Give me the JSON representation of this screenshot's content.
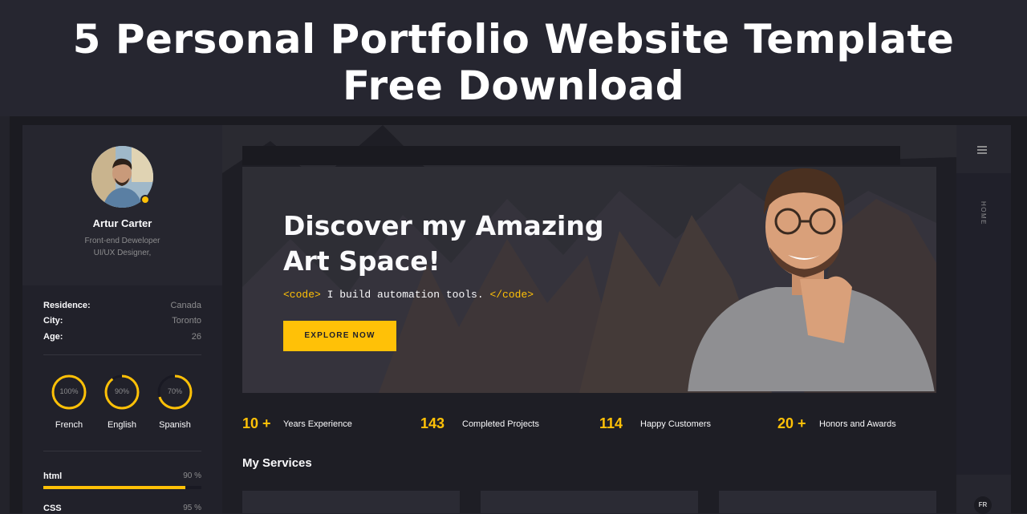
{
  "banner": {
    "line1": "5 Personal Portfolio Website Template",
    "line2": "Free Download"
  },
  "profile": {
    "name": "Artur Carter",
    "role_line1": "Front-end Deweloper",
    "role_line2": "UI/UX Designer,"
  },
  "info": [
    {
      "key": "Residence:",
      "value": "Canada"
    },
    {
      "key": "City:",
      "value": "Toronto"
    },
    {
      "key": "Age:",
      "value": "26"
    }
  ],
  "languages": [
    {
      "name": "French",
      "percent_text": "100%",
      "level": 1.0
    },
    {
      "name": "English",
      "percent_text": "90%",
      "level": 0.9
    },
    {
      "name": "Spanish",
      "percent_text": "70%",
      "level": 0.7
    }
  ],
  "skills": [
    {
      "name": "html",
      "percent_text": "90 %",
      "level": 0.9
    },
    {
      "name": "CSS",
      "percent_text": "95 %",
      "level": 0.95
    }
  ],
  "hero": {
    "title_line1": "Discover my Amazing",
    "title_line2": "Art Space!",
    "code_open": "<code>",
    "code_text": " I build automation tools. ",
    "code_close": "</code>",
    "button_label": "EXPLORE NOW"
  },
  "stats": [
    {
      "number": "10 +",
      "label": "Years Experience"
    },
    {
      "number": "143",
      "label": "Completed Projects"
    },
    {
      "number": "114",
      "label": "Happy Customers"
    },
    {
      "number": "20 +",
      "label": "Honors and Awards"
    }
  ],
  "services": {
    "title": "My Services"
  },
  "rail": {
    "nav_label": "HOME",
    "language": "FR"
  },
  "colors": {
    "accent": "#ffc107",
    "background": "#1e1e25",
    "panel": "#21212a"
  }
}
